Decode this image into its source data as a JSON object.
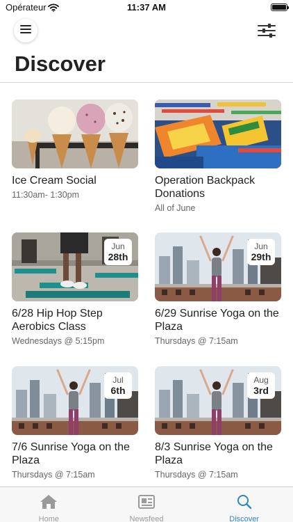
{
  "status_bar": {
    "carrier": "Opérateur",
    "time": "11:37 AM"
  },
  "header": {
    "title": "Discover"
  },
  "events": [
    {
      "title": "Ice Cream Social",
      "subtitle": "11:30am- 1:30pm",
      "image": "ice-cream-cones"
    },
    {
      "title": "Operation Backpack Donations",
      "subtitle": "All of June",
      "image": "school-supplies"
    },
    {
      "title": "6/28 Hip Hop Step Aerobics Class",
      "subtitle": "Wednesdays @ 5:15pm",
      "image": "step-aerobics",
      "date": {
        "month": "Jun",
        "day": "28th"
      }
    },
    {
      "title": "6/29 Sunrise Yoga on the Plaza",
      "subtitle": "Thursdays @ 7:15am",
      "image": "rooftop-yoga",
      "date": {
        "month": "Jun",
        "day": "29th"
      }
    },
    {
      "title": "7/6 Sunrise Yoga on the Plaza",
      "subtitle": "Thursdays @ 7:15am",
      "image": "rooftop-yoga",
      "date": {
        "month": "Jul",
        "day": "6th"
      }
    },
    {
      "title": "8/3 Sunrise Yoga on the Plaza",
      "subtitle": "Thursdays @ 7:15am",
      "image": "rooftop-yoga",
      "date": {
        "month": "Aug",
        "day": "3rd"
      }
    }
  ],
  "tab_bar": {
    "tabs": [
      {
        "label": "Home",
        "icon": "home-icon"
      },
      {
        "label": "Newsfeed",
        "icon": "newsfeed-icon"
      },
      {
        "label": "Discover",
        "icon": "search-icon",
        "active": true
      }
    ]
  },
  "colors": {
    "accent": "#2f86c4",
    "inactive_tab": "#9a9a9a"
  }
}
